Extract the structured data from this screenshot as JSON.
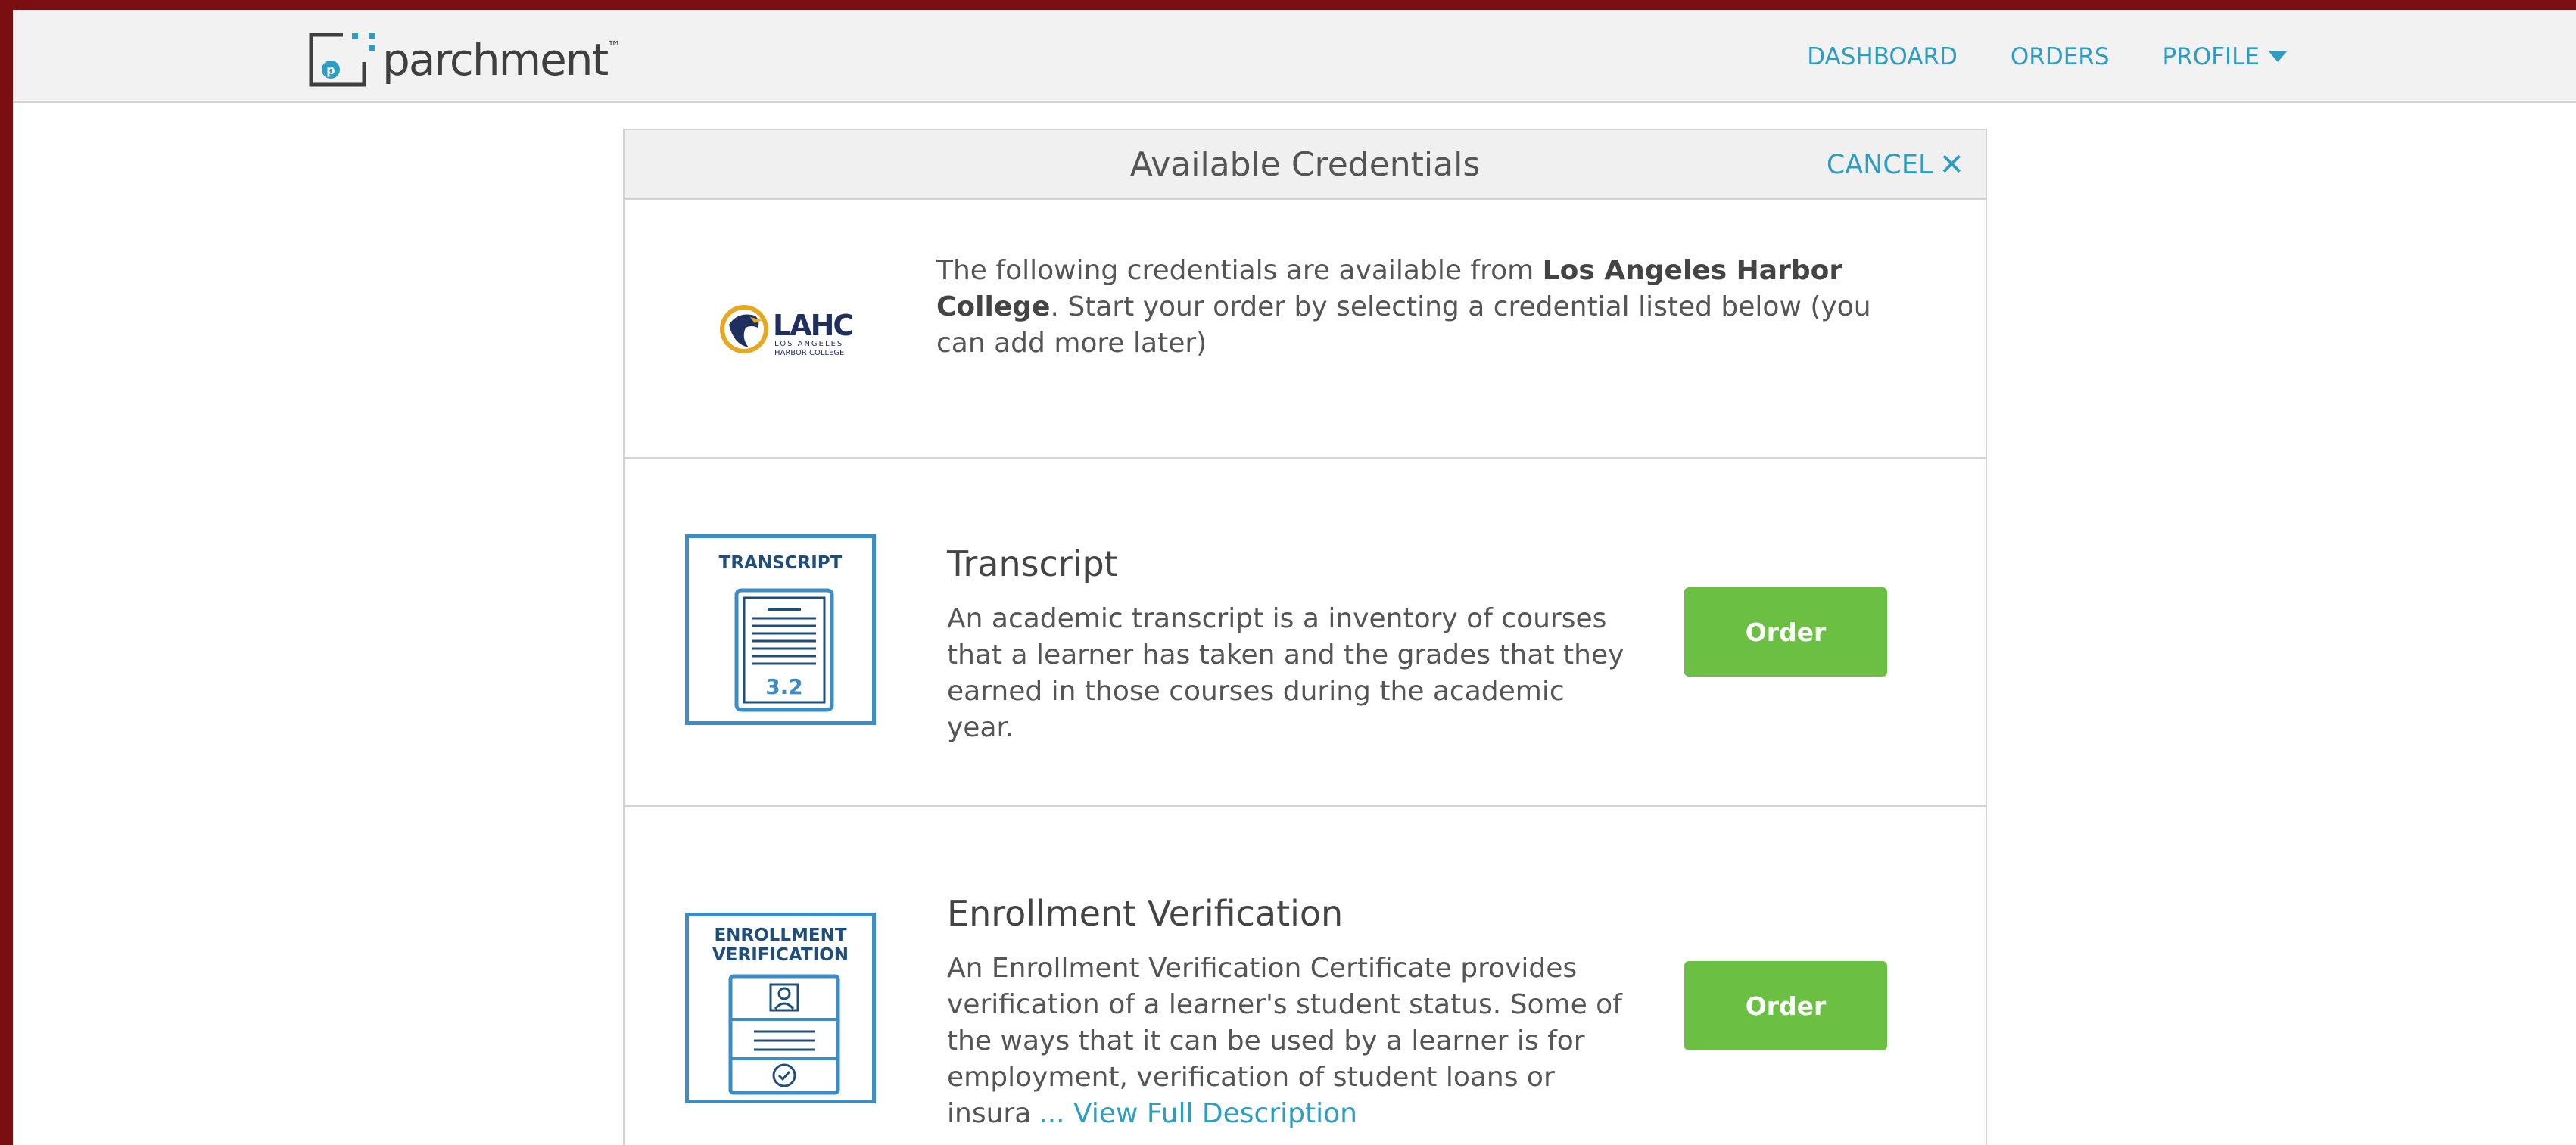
{
  "header": {
    "logo_text": "parchment",
    "nav": [
      {
        "label": "DASHBOARD"
      },
      {
        "label": "ORDERS"
      },
      {
        "label": "PROFILE"
      }
    ]
  },
  "panel": {
    "title": "Available Credentials",
    "cancel_label": "CANCEL"
  },
  "intro": {
    "logo_text": "LAHC",
    "logo_sub1": "LOS ANGELES",
    "logo_sub2": "HARBOR COLLEGE",
    "text_before": "The following credentials are available from ",
    "school_name": "Los Angeles Harbor College",
    "text_after": ". Start your order by selecting a credential listed below (you can add more later)"
  },
  "credentials": [
    {
      "icon_label": "TRANSCRIPT",
      "icon_value": "3.2",
      "title": "Transcript",
      "description": "An academic transcript is a inventory of courses that a learner has taken and the grades that they earned in those courses during the academic year.",
      "order_label": "Order"
    },
    {
      "icon_label_line1": "ENROLLMENT",
      "icon_label_line2": "VERIFICATION",
      "title": "Enrollment Verification",
      "description": "An Enrollment Verification Certificate provides verification of a learner's student status. Some of the ways that it can be used by a learner is for employment, verification of student loans or insura",
      "more_link": "... View Full Description",
      "order_label": "Order"
    }
  ],
  "colors": {
    "accent": "#2f9dc1",
    "order_button": "#6bbf43",
    "icon_border": "#3c8cc5",
    "frame": "#7a0e10"
  }
}
